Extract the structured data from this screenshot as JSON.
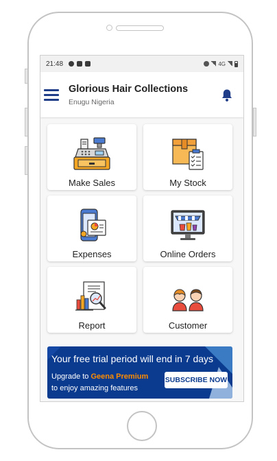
{
  "status_bar": {
    "time": "21:48",
    "network_label": "4G"
  },
  "app_bar": {
    "title": "Glorious Hair Collections",
    "subtitle": "Enugu Nigeria"
  },
  "menu": [
    {
      "label": "Make Sales",
      "icon": "cash-register-icon"
    },
    {
      "label": "My Stock",
      "icon": "stock-box-icon"
    },
    {
      "label": "Expenses",
      "icon": "expenses-phone-icon"
    },
    {
      "label": "Online Orders",
      "icon": "online-store-icon"
    },
    {
      "label": "Report",
      "icon": "report-chart-icon"
    },
    {
      "label": "Customer",
      "icon": "customers-icon"
    }
  ],
  "banner": {
    "headline": "Your free trial period will end in 7 days",
    "upgrade_prefix": "Upgrade to",
    "premium_name": "Geena Premium",
    "line2": "to enjoy amazing features",
    "button_label": "SUBSCRIBE NOW"
  },
  "colors": {
    "brand_blue": "#1f3c88",
    "banner_blue": "#0b3b8f",
    "premium_orange": "#ff8c00"
  }
}
